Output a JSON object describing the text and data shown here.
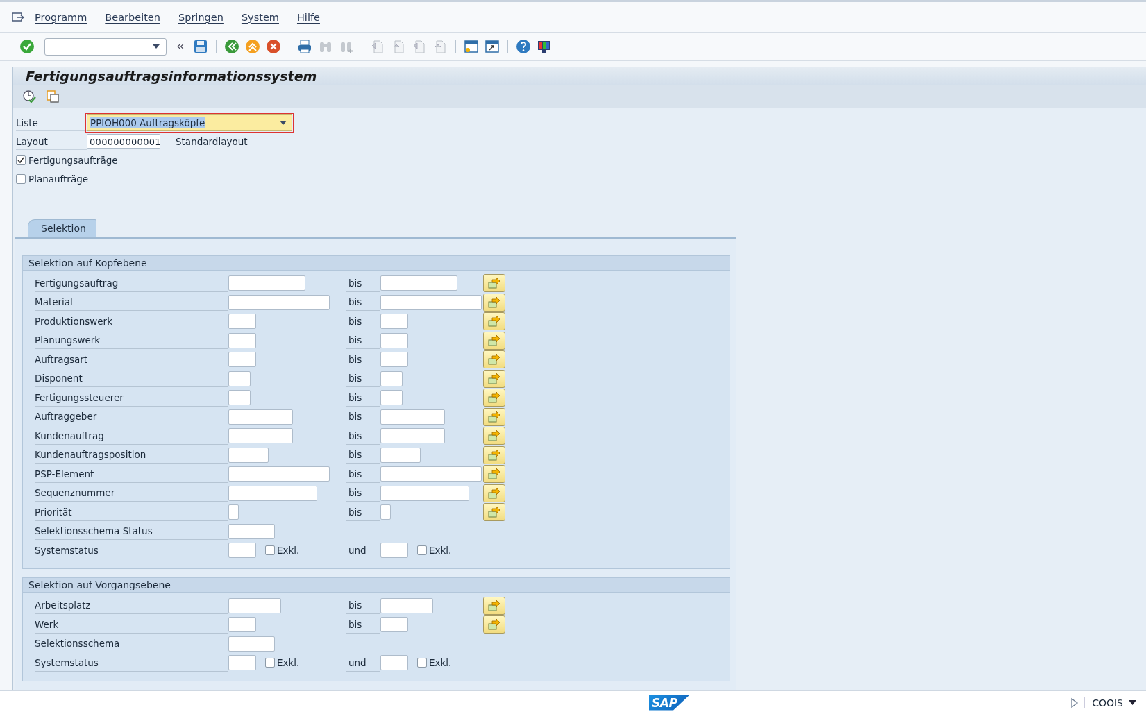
{
  "menu": [
    {
      "label": "Programm"
    },
    {
      "label": "Bearbeiten"
    },
    {
      "label": "Springen"
    },
    {
      "label": "System"
    },
    {
      "label": "Hilfe"
    }
  ],
  "title": "Fertigungsauftragsinformationssystem",
  "liste": {
    "label": "Liste",
    "value": "PPIOH000 Auftragsköpfe"
  },
  "layout": {
    "label": "Layout",
    "value": "000000000001",
    "description": "Standardlayout"
  },
  "options": [
    {
      "label": "Fertigungsaufträge",
      "checked": true
    },
    {
      "label": "Planaufträge",
      "checked": false
    }
  ],
  "tabs": [
    {
      "label": "Selektion",
      "selected": true
    }
  ],
  "groups": [
    {
      "title": "Selektion auf Kopfebene",
      "rows": [
        {
          "kind": "range",
          "label": "Fertigungsauftrag",
          "connector": "bis"
        },
        {
          "kind": "range",
          "label": "Material",
          "connector": "bis"
        },
        {
          "kind": "range",
          "label": "Produktionswerk",
          "connector": "bis"
        },
        {
          "kind": "range",
          "label": "Planungswerk",
          "connector": "bis"
        },
        {
          "kind": "range",
          "label": "Auftragsart",
          "connector": "bis"
        },
        {
          "kind": "range",
          "label": "Disponent",
          "connector": "bis"
        },
        {
          "kind": "range",
          "label": "Fertigungssteuerer",
          "connector": "bis"
        },
        {
          "kind": "range",
          "label": "Auftraggeber",
          "connector": "bis"
        },
        {
          "kind": "range",
          "label": "Kundenauftrag",
          "connector": "bis"
        },
        {
          "kind": "range",
          "label": "Kundenauftragsposition",
          "connector": "bis"
        },
        {
          "kind": "range",
          "label": "PSP-Element",
          "connector": "bis"
        },
        {
          "kind": "range",
          "label": "Sequenznummer",
          "connector": "bis"
        },
        {
          "kind": "range",
          "label": "Priorität",
          "connector": "bis"
        },
        {
          "kind": "single",
          "label": "Selektionsschema Status"
        },
        {
          "kind": "status",
          "label": "Systemstatus",
          "connector": "und",
          "exclude1": {
            "label": "Exkl.",
            "checked": false
          },
          "exclude2": {
            "label": "Exkl.",
            "checked": false
          }
        }
      ]
    },
    {
      "title": "Selektion auf Vorgangsebene",
      "rows": [
        {
          "kind": "range",
          "label": "Arbeitsplatz",
          "connector": "bis"
        },
        {
          "kind": "range",
          "label": "Werk",
          "connector": "bis"
        },
        {
          "kind": "single",
          "label": "Selektionsschema"
        },
        {
          "kind": "status",
          "label": "Systemstatus",
          "connector": "und",
          "exclude1": {
            "label": "Exkl.",
            "checked": false
          },
          "exclude2": {
            "label": "Exkl.",
            "checked": false
          }
        }
      ]
    }
  ],
  "status_bar": {
    "logo": "SAP",
    "transaction": "COOIS"
  }
}
